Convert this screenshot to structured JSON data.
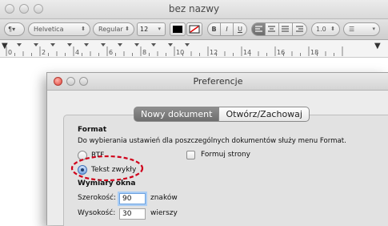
{
  "window": {
    "title": "bez nazwy"
  },
  "format_bar": {
    "style_btn": "¶▾",
    "font_family": "Helvetica",
    "font_style": "Regular",
    "font_size": "12",
    "bold": "B",
    "italic": "I",
    "underline": "U",
    "line_spacing": "1.0",
    "list": "☰"
  },
  "ruler": {
    "ticks": [
      "0",
      "2",
      "4",
      "6",
      "8",
      "10",
      "12",
      "14",
      "16",
      "18"
    ]
  },
  "preferences": {
    "title": "Preferencje",
    "tabs": {
      "new_document": "Nowy dokument",
      "open_save": "Otwórz/Zachowaj"
    },
    "format_heading": "Format",
    "format_desc": "Do wybierania ustawień dla poszczególnych dokumentów służy menu Format.",
    "rtf_label": "RTF",
    "plain_text_label": "Tekst zwykły",
    "wrap_to_page_label": "Formuj strony",
    "window_size_heading": "Wymiary okna",
    "width_label": "Szerokość:",
    "width_value": "90",
    "width_unit": "znaków",
    "height_label": "Wysokość:",
    "height_value": "30",
    "height_unit": "wierszy",
    "selected_format": "Tekst zwykły",
    "highlight_color": "#d0021b"
  }
}
